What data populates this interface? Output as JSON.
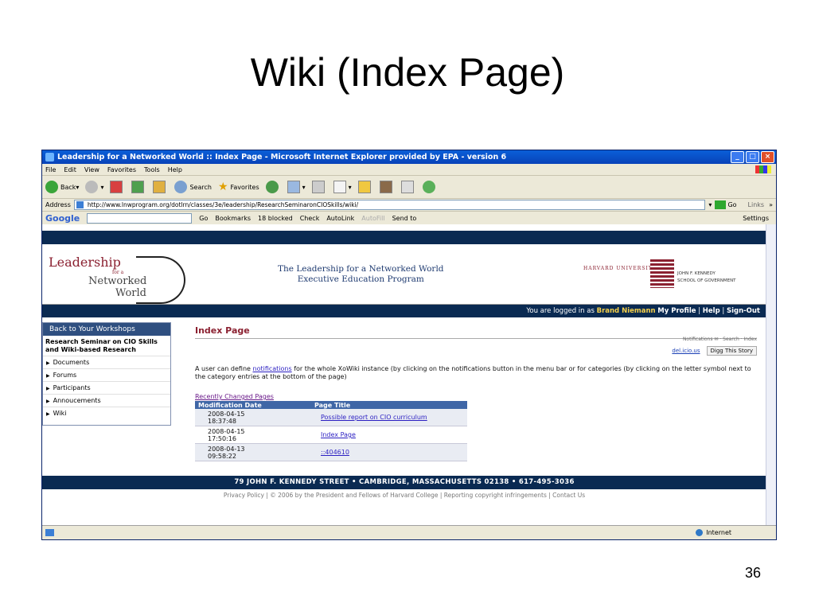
{
  "slide": {
    "title": "Wiki (Index Page)",
    "number": "36"
  },
  "browser": {
    "title": "Leadership for a Networked World :: Index Page - Microsoft Internet Explorer provided by EPA - version 6",
    "menu": [
      "File",
      "Edit",
      "View",
      "Favorites",
      "Tools",
      "Help"
    ],
    "toolbar": {
      "back": "Back",
      "search": "Search",
      "favorites": "Favorites"
    },
    "address_label": "Address",
    "address": "http://www.lnwprogram.org/dotlrn/classes/3e/leadership/ResearchSeminaronCIOSkills/wiki/",
    "go": "Go",
    "links": "Links",
    "google": {
      "logo": "Google",
      "go": "Go",
      "bookmarks": "Bookmarks",
      "blocked": "18 blocked",
      "check": "Check",
      "autolink": "AutoLink",
      "autofill": "AutoFill",
      "sendto": "Send to",
      "settings": "Settings"
    },
    "status": {
      "zone": "Internet"
    }
  },
  "site": {
    "logo": {
      "l1": "Leadership",
      "l2": "for a",
      "l3": "Networked",
      "l4": "World"
    },
    "program": [
      "The Leadership for a Networked World",
      "Executive Education Program"
    ],
    "harvard": {
      "university": "HARVARD UNIVERSITY",
      "school_line1": "JOHN F. KENNEDY",
      "school_line2": "SCHOOL OF GOVERNMENT"
    },
    "userbar": {
      "prefix": "You are logged in as",
      "user": "Brand Niemann",
      "profile": "My Profile",
      "help": "Help",
      "signout": "Sign-Out"
    },
    "sidebar": {
      "header": "Back to Your Workshops",
      "course": "Research Seminar on CIO Skills and Wiki-based Research",
      "items": [
        "Documents",
        "Forums",
        "Participants",
        "Annoucements",
        "Wiki"
      ]
    },
    "main": {
      "heading": "Index Page",
      "util": "Notifications ✉ · Search · Index",
      "delicious": "del.icio.us",
      "digg": "Digg This Story",
      "desc_pre": "A user can define ",
      "desc_link": "notifications",
      "desc_post": " for the whole XoWiki instance (by clicking on the notifications button in the menu bar or for categories (by clicking on the letter symbol next to the category entries at the bottom of the page)",
      "recent": "Recently Changed Pages",
      "columns": [
        "Modification Date",
        "Page Title"
      ],
      "rows": [
        {
          "date": "2008-04-15",
          "time": "18:37:48",
          "title": "Possible report on CIO curriculum"
        },
        {
          "date": "2008-04-15",
          "time": "17:50:16",
          "title": "Index Page"
        },
        {
          "date": "2008-04-13",
          "time": "09:58:22",
          "title": "::404610"
        }
      ]
    },
    "footer": {
      "address": "79 JOHN F. KENNEDY STREET   •   CAMBRIDGE, MASSACHUSETTS  02138   •   617-495-3036",
      "links": "Privacy Policy | © 2006 by the President and Fellows of Harvard College | Reporting copyright infringements | Contact Us"
    }
  }
}
